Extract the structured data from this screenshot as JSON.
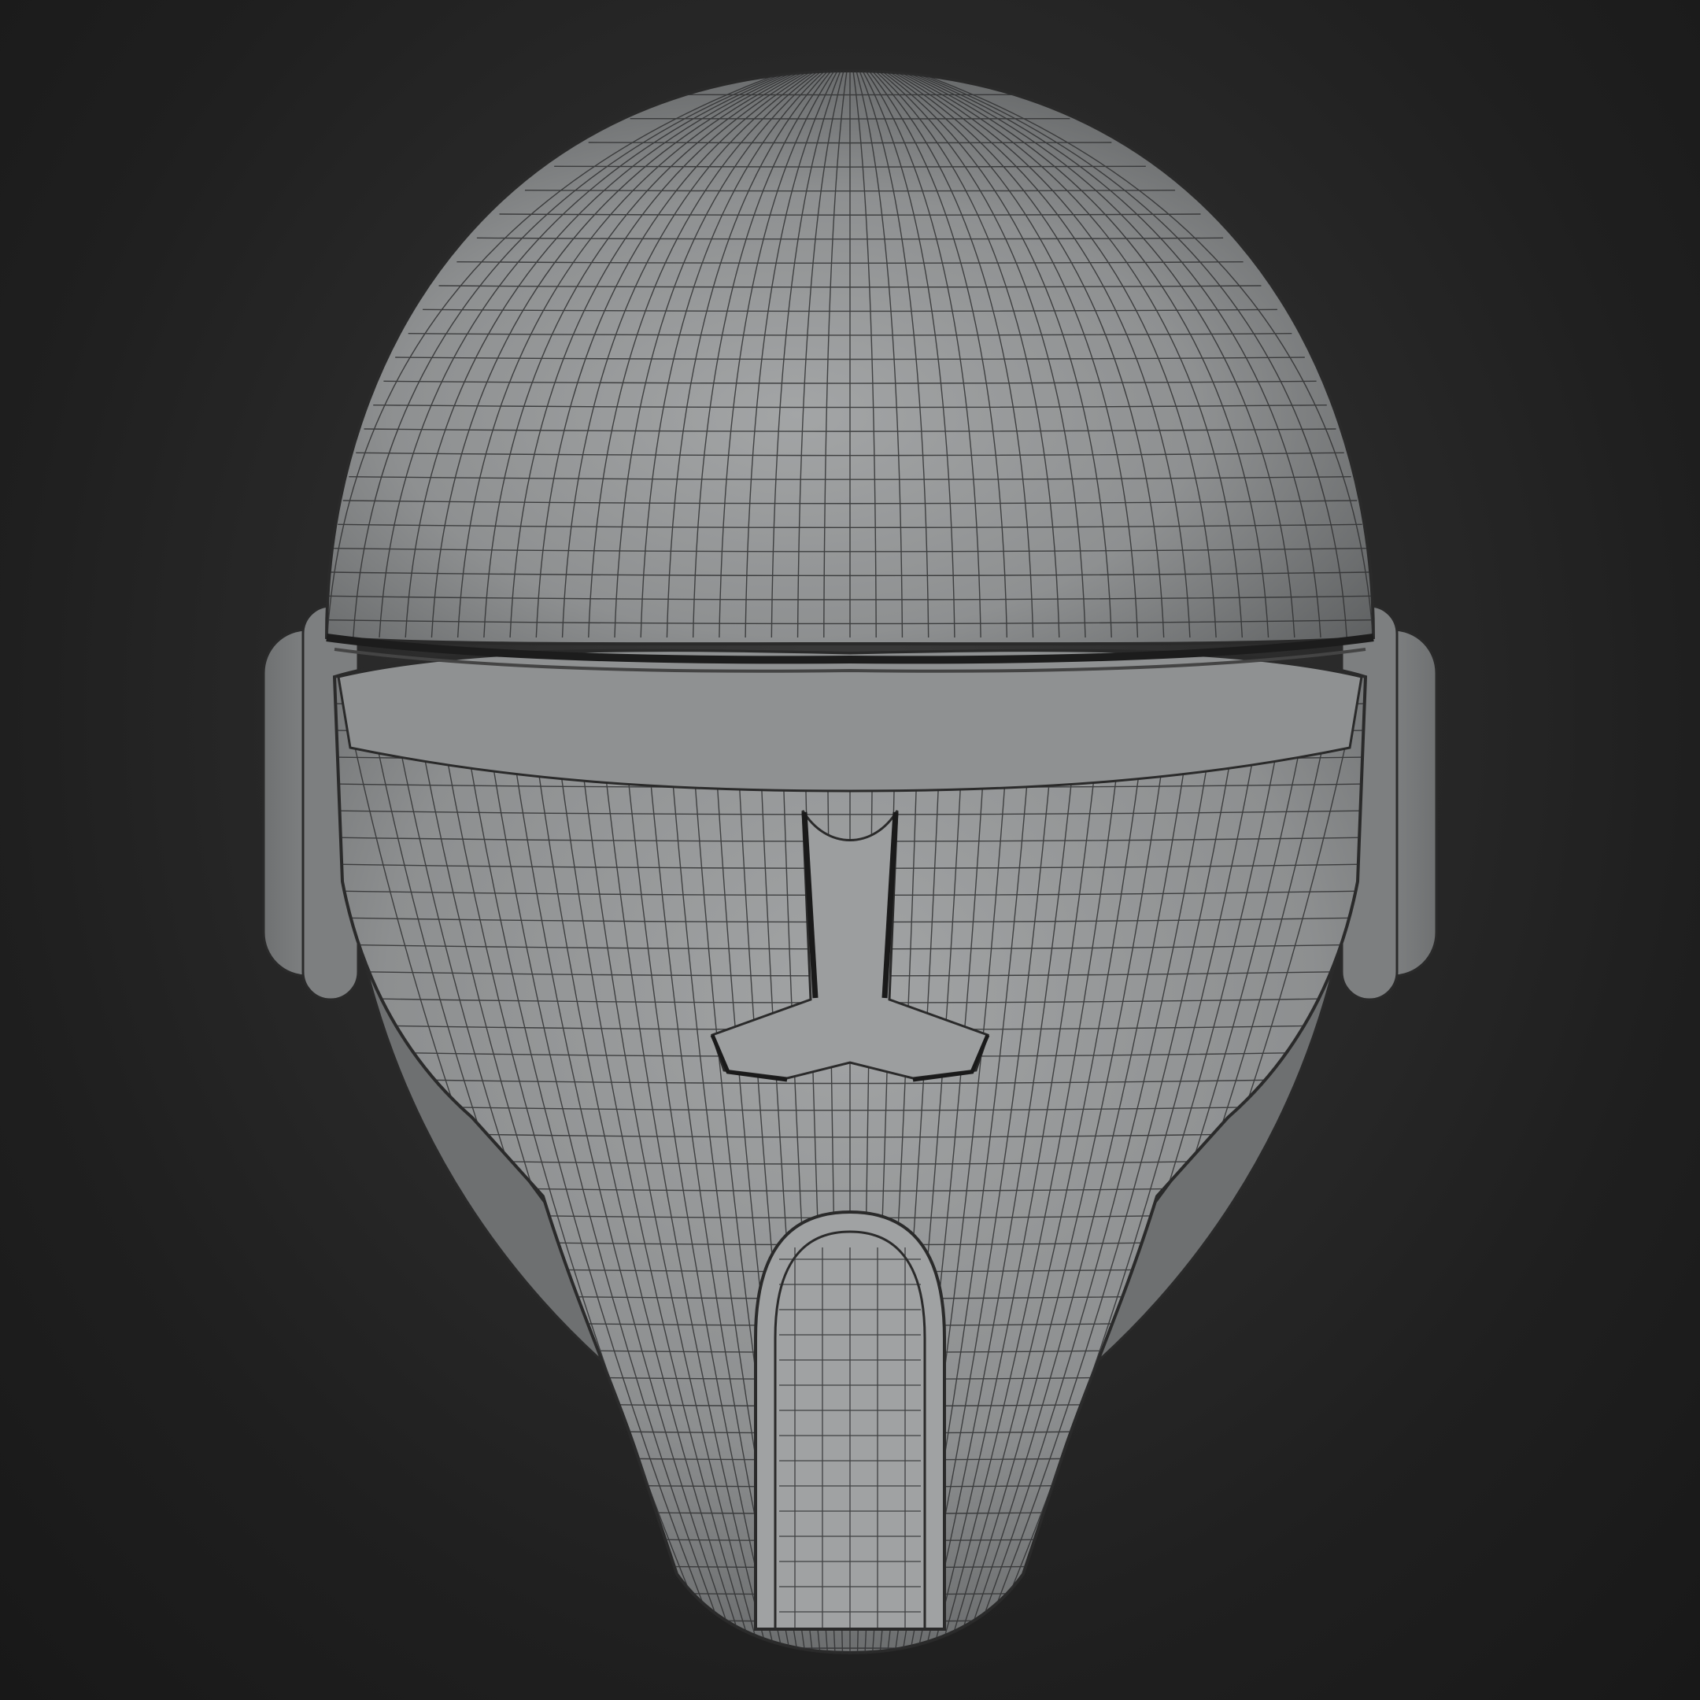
{
  "viewport": {
    "background_color": "#1d1d1d",
    "display_mode": "wireframe-on-shaded"
  },
  "model": {
    "subject": "helmet",
    "surface_color": "#9a9c9d",
    "wire_color": "#2a2a2a",
    "visible_text": []
  }
}
